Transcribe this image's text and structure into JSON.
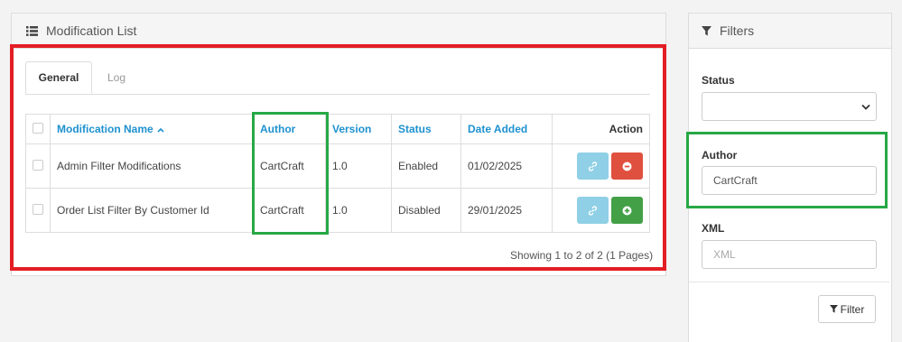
{
  "list_panel": {
    "title": "Modification List",
    "icon": "list-icon"
  },
  "tabs": [
    {
      "label": "General",
      "active": true
    },
    {
      "label": "Log",
      "active": false
    }
  ],
  "table": {
    "headers": {
      "name": "Modification Name",
      "author": "Author",
      "version": "Version",
      "status": "Status",
      "date_added": "Date Added",
      "action": "Action"
    },
    "sort_indicator": "^",
    "rows": [
      {
        "name": "Admin Filter Modifications",
        "author": "CartCraft",
        "version": "1.0",
        "status": "Enabled",
        "date_added": "01/02/2025",
        "toggle": "disable"
      },
      {
        "name": "Order List Filter By Customer Id",
        "author": "CartCraft",
        "version": "1.0",
        "status": "Disabled",
        "date_added": "29/01/2025",
        "toggle": "enable"
      }
    ],
    "pagination_text": "Showing 1 to 2 of 2 (1 Pages)"
  },
  "filter_panel": {
    "title": "Filters",
    "status_label": "Status",
    "status_value": "",
    "author_label": "Author",
    "author_value": "CartCraft",
    "xml_label": "XML",
    "xml_placeholder": "XML",
    "button_label": "Filter"
  },
  "colors": {
    "link": "#1e91cf",
    "highlight_red": "#e31e25",
    "highlight_green": "#27a845",
    "btn_info": "#8fd0e6",
    "btn_danger": "#e0503f",
    "btn_success": "#43a047"
  }
}
